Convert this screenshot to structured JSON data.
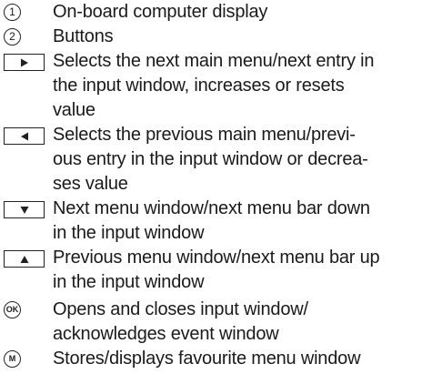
{
  "legend": {
    "items": [
      {
        "marker": "1",
        "lines": [
          "On-board computer display"
        ]
      },
      {
        "marker": "2",
        "lines": [
          "Buttons"
        ]
      },
      {
        "marker": "right-arrow-button-icon",
        "lines": [
          "Selects the next main menu/next entry in",
          "the input window, increases or resets",
          "value"
        ]
      },
      {
        "marker": "left-arrow-button-icon",
        "lines": [
          "Selects the previous main menu/previ-",
          "ous entry in the input window or decrea-",
          "ses value"
        ]
      },
      {
        "marker": "down-arrow-button-icon",
        "lines": [
          "Next menu window/next menu bar down",
          "in the input window"
        ]
      },
      {
        "marker": "up-arrow-button-icon",
        "lines": [
          "Previous menu window/next menu bar up",
          "in the input window"
        ]
      },
      {
        "marker": "OK",
        "lines": [
          "Opens and closes input window/",
          "acknowledges event window"
        ]
      },
      {
        "marker": "M",
        "lines": [
          "Stores/displays favourite menu window"
        ]
      }
    ]
  }
}
